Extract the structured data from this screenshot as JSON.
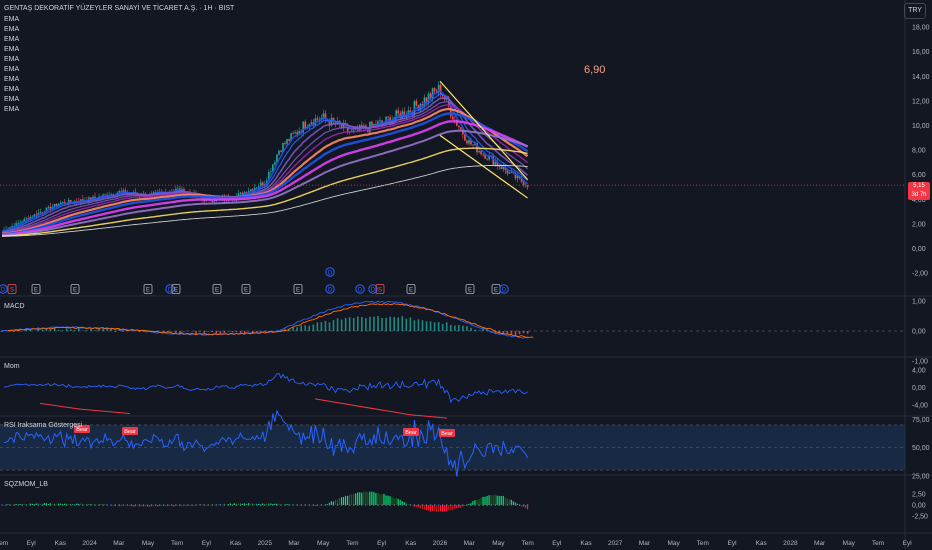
{
  "header": {
    "title": "GENTAŞ DEKORATİF YÜZEYLER SANAYİ VE TİCARET A.Ş. · 1H · BIST",
    "currency_button": "TRY",
    "ema_labels": [
      "EMA",
      "EMA",
      "EMA",
      "EMA",
      "EMA",
      "EMA",
      "EMA",
      "EMA",
      "EMA",
      "EMA"
    ],
    "annotation_value": "6,90",
    "last_price": "5,15",
    "last_price_sub": "3d 7h"
  },
  "colors": {
    "background": "#131722",
    "bull": "#26a69a",
    "bear": "#ef5350",
    "pattern_lines": "#ffeb6a",
    "rsi_line": "#2962ff",
    "rsi_band": "#1e3a5f",
    "bear_label": "#f23645",
    "ema_colors": [
      "#1e53e5",
      "#2962ff",
      "#7e57c2",
      "#7e57c2",
      "#9c27b0",
      "#ff8a65",
      "#1e53e5",
      "#e040fb",
      "#9575cd",
      "#ffe066",
      "#e0e0e0"
    ]
  },
  "price_axis": {
    "ticks": [
      "18,00",
      "16,00",
      "14,00",
      "12,00",
      "10,00",
      "8,00",
      "6,00",
      "4,00",
      "2,00",
      "0,00",
      "-2,00"
    ]
  },
  "time_axis": {
    "labels": [
      "Tem",
      "Eyl",
      "Kas",
      "2024",
      "Mar",
      "May",
      "Tem",
      "Eyl",
      "Kas",
      "2025",
      "Mar",
      "May",
      "Tem",
      "Eyl",
      "Kas",
      "2026",
      "Mar",
      "May",
      "Tem",
      "Eyl",
      "Kas",
      "2027",
      "Mar",
      "May",
      "Tem",
      "Eyl",
      "Kas",
      "2028",
      "Mar",
      "May",
      "Tem",
      "Eyl"
    ]
  },
  "event_markers": [
    "D",
    "S",
    "E",
    "E",
    "E",
    "D",
    "E",
    "E",
    "E",
    "E",
    "D",
    "D",
    "D",
    "S",
    "E",
    "E",
    "E",
    "D"
  ],
  "panes": {
    "macd": {
      "label": "MACD",
      "ticks": [
        "1,00",
        "0,00",
        "-1,00"
      ]
    },
    "mom": {
      "label": "Mom",
      "ticks": [
        "4,00",
        "0,00",
        "-4,00"
      ]
    },
    "rsi": {
      "label": "RSI Iraksama Göstergesi",
      "ticks": [
        "75,00",
        "50,00",
        "25,00"
      ],
      "bear_labels": [
        "Bear",
        "Bear",
        "Bear",
        "Bear"
      ]
    },
    "sqz": {
      "label": "SQZMOM_LB",
      "ticks": [
        "2,50",
        "0,00",
        "-2,50"
      ]
    }
  },
  "chart_data": {
    "type": "line",
    "title": "GENTAŞ DEKORATİF YÜZEYLER SANAYİ VE TİCARET A.Ş. · 1H · BIST",
    "x_range": [
      "2023-07",
      "2026-07"
    ],
    "ylim": [
      -3,
      19
    ],
    "close_points": [
      [
        "2023-07",
        1.4
      ],
      [
        "2023-09",
        2.6
      ],
      [
        "2023-11",
        3.7
      ],
      [
        "2024-01",
        4.0
      ],
      [
        "2024-03",
        4.6
      ],
      [
        "2024-05",
        4.3
      ],
      [
        "2024-07",
        4.8
      ],
      [
        "2024-09",
        3.9
      ],
      [
        "2024-11",
        4.2
      ],
      [
        "2025-01",
        5.4
      ],
      [
        "2025-02",
        8.1
      ],
      [
        "2025-04",
        10.4
      ],
      [
        "2025-05",
        10.6
      ],
      [
        "2025-07",
        9.4
      ],
      [
        "2025-09",
        10.2
      ],
      [
        "2025-11",
        11.3
      ],
      [
        "2026-01",
        13.0
      ],
      [
        "2026-02",
        10.5
      ],
      [
        "2026-03",
        8.6
      ],
      [
        "2026-05",
        6.8
      ],
      [
        "2026-06",
        5.9
      ],
      [
        "2026-07",
        5.15
      ]
    ],
    "falling_wedge": {
      "upper": [
        [
          "2026-01",
          13.6
        ],
        [
          "2026-07",
          5.6
        ]
      ],
      "lower": [
        [
          "2026-01",
          9.2
        ],
        [
          "2026-07",
          4.1
        ]
      ]
    },
    "annotation": "6,90",
    "last_price": 5.15
  }
}
